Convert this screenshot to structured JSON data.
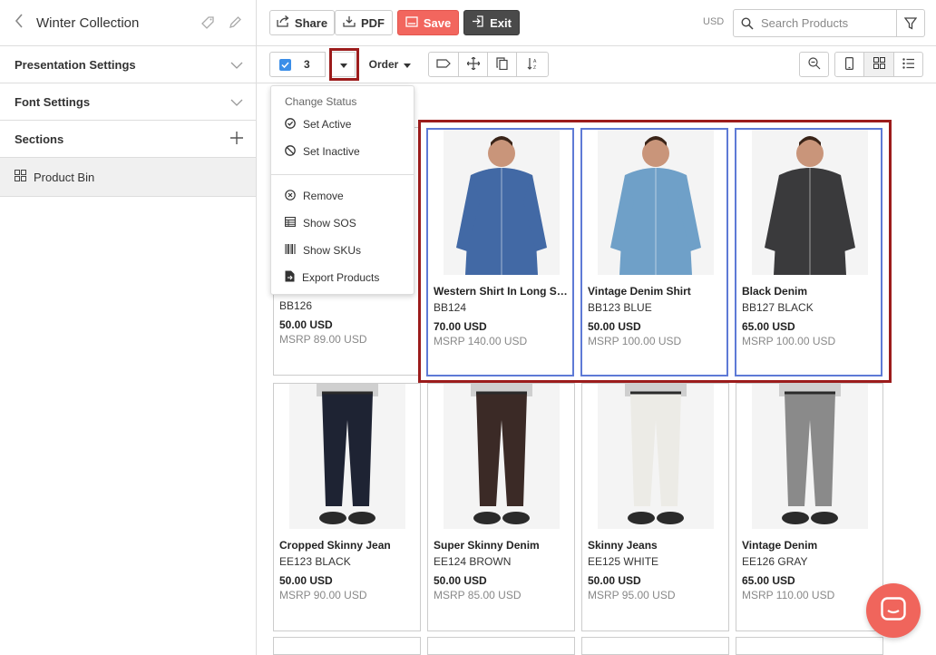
{
  "sidebar": {
    "title": "Winter Collection",
    "sections": [
      {
        "label": "Presentation Settings"
      },
      {
        "label": "Font Settings"
      },
      {
        "label": "Sections"
      }
    ],
    "bin_label": "Product Bin"
  },
  "topbar": {
    "share": "Share",
    "pdf": "PDF",
    "save": "Save",
    "exit": "Exit",
    "currency": "USD",
    "search_placeholder": "Search Products"
  },
  "toolbar": {
    "selected_count": "3",
    "order": "Order"
  },
  "menu": {
    "heading": "Change Status",
    "set_active": "Set Active",
    "set_inactive": "Set Inactive",
    "remove": "Remove",
    "show_sos": "Show SOS",
    "show_skus": "Show SKUs",
    "export": "Export Products"
  },
  "products": [
    {
      "name": "",
      "sku": "BB126",
      "price": "50.00 USD",
      "msrp": "MSRP 89.00 USD",
      "shirt": "#3d5e8f"
    },
    {
      "name": "Western Shirt In Long Sle...",
      "sku": "BB124",
      "price": "70.00 USD",
      "msrp": "MSRP 140.00 USD",
      "shirt": "#4269a5"
    },
    {
      "name": "Vintage Denim Shirt",
      "sku": "BB123 BLUE",
      "price": "50.00 USD",
      "msrp": "MSRP 100.00 USD",
      "shirt": "#6fa0c8"
    },
    {
      "name": "Black Denim",
      "sku": "BB127 BLACK",
      "price": "65.00 USD",
      "msrp": "MSRP 100.00 USD",
      "shirt": "#3a3a3c"
    },
    {
      "name": "Cropped Skinny Jean",
      "sku": "EE123 BLACK",
      "price": "50.00 USD",
      "msrp": "MSRP 90.00 USD",
      "pants": "#1e2333"
    },
    {
      "name": "Super Skinny Denim",
      "sku": "EE124 BROWN",
      "price": "50.00 USD",
      "msrp": "MSRP 85.00 USD",
      "pants": "#3b2a26"
    },
    {
      "name": "Skinny Jeans",
      "sku": "EE125 WHITE",
      "price": "50.00 USD",
      "msrp": "MSRP 95.00 USD",
      "pants": "#ecebe6"
    },
    {
      "name": "Vintage Denim",
      "sku": "EE126 GRAY",
      "price": "65.00 USD",
      "msrp": "MSRP 110.00 USD",
      "pants": "#8a8a8a"
    }
  ],
  "colors": {
    "accent_red": "#f2665e",
    "selection_blue": "#5e7ad6",
    "highlight_red": "#9c1c1c",
    "checkbox_blue": "#3b8ee8"
  }
}
